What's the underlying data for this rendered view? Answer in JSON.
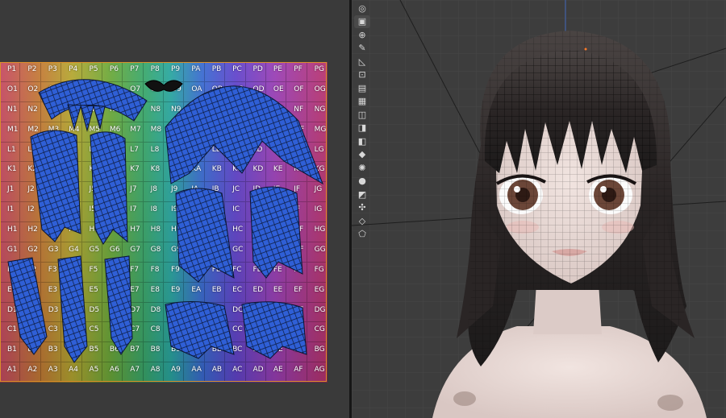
{
  "uv_editor": {
    "grid_rows": [
      [
        "P1",
        "P2",
        "P3",
        "P4",
        "P5",
        "P6",
        "P7",
        "P8",
        "P9",
        "PA",
        "PB",
        "PC",
        "PD",
        "PE",
        "PF",
        "PG"
      ],
      [
        "O1",
        "O2",
        "O3",
        "O4",
        "O5",
        "O6",
        "O7",
        "O8",
        "O9",
        "OA",
        "OB",
        "OC",
        "OD",
        "OE",
        "OF",
        "OG"
      ],
      [
        "N1",
        "N2",
        "N3",
        "N4",
        "N5",
        "N6",
        "N7",
        "N8",
        "N9",
        "NA",
        "NB",
        "NC",
        "ND",
        "NE",
        "NF",
        "NG"
      ],
      [
        "M1",
        "M2",
        "M3",
        "M4",
        "M5",
        "M6",
        "M7",
        "M8",
        "M9",
        "MA",
        "MB",
        "MC",
        "MD",
        "ME",
        "MF",
        "MG"
      ],
      [
        "L1",
        "L2",
        "L3",
        "L4",
        "L5",
        "L6",
        "L7",
        "L8",
        "L9",
        "LA",
        "LB",
        "LC",
        "LD",
        "LE",
        "LF",
        "LG"
      ],
      [
        "K1",
        "K2",
        "K3",
        "K4",
        "K5",
        "K6",
        "K7",
        "K8",
        "K9",
        "KA",
        "KB",
        "KC",
        "KD",
        "KE",
        "KF",
        "KG"
      ],
      [
        "J1",
        "J2",
        "J3",
        "J4",
        "J5",
        "J6",
        "J7",
        "J8",
        "J9",
        "JA",
        "JB",
        "JC",
        "JD",
        "JE",
        "JF",
        "JG"
      ],
      [
        "I1",
        "I2",
        "I3",
        "I4",
        "I5",
        "I6",
        "I7",
        "I8",
        "I9",
        "IA",
        "IB",
        "IC",
        "ID",
        "IE",
        "IF",
        "IG"
      ],
      [
        "H1",
        "H2",
        "H3",
        "H4",
        "H5",
        "H6",
        "H7",
        "H8",
        "H9",
        "HA",
        "HB",
        "HC",
        "HD",
        "HE",
        "HF",
        "HG"
      ],
      [
        "G1",
        "G2",
        "G3",
        "G4",
        "G5",
        "G6",
        "G7",
        "G8",
        "G9",
        "GA",
        "GB",
        "GC",
        "GD",
        "GE",
        "GF",
        "GG"
      ],
      [
        "F1",
        "F2",
        "F3",
        "F4",
        "F5",
        "F6",
        "F7",
        "F8",
        "F9",
        "FA",
        "FB",
        "FC",
        "FD",
        "FE",
        "FF",
        "FG"
      ],
      [
        "E1",
        "E2",
        "E3",
        "E4",
        "E5",
        "E6",
        "E7",
        "E8",
        "E9",
        "EA",
        "EB",
        "EC",
        "ED",
        "EE",
        "EF",
        "EG"
      ],
      [
        "D1",
        "D2",
        "D3",
        "D4",
        "D5",
        "D6",
        "D7",
        "D8",
        "D9",
        "DA",
        "DB",
        "DC",
        "DD",
        "DE",
        "DF",
        "DG"
      ],
      [
        "C1",
        "C2",
        "C3",
        "C4",
        "C5",
        "C6",
        "C7",
        "C8",
        "C9",
        "CA",
        "CB",
        "CC",
        "CD",
        "CE",
        "CF",
        "CG"
      ],
      [
        "B1",
        "B2",
        "B3",
        "B4",
        "B5",
        "B6",
        "B7",
        "B8",
        "B9",
        "BA",
        "BB",
        "BC",
        "BD",
        "BE",
        "BF",
        "BG"
      ],
      [
        "A1",
        "A2",
        "A3",
        "A4",
        "A5",
        "A6",
        "A7",
        "A8",
        "A9",
        "AA",
        "AB",
        "AC",
        "AD",
        "AE",
        "AF",
        "AG"
      ]
    ],
    "border_color": "#d98f2a",
    "island_color": "#2f5fd6"
  },
  "toolbar": {
    "tools": [
      {
        "name": "cursor-icon",
        "glyph": "◎"
      },
      {
        "name": "box-select-icon",
        "glyph": "▣"
      },
      {
        "name": "transform-icon",
        "glyph": "⊕"
      },
      {
        "name": "annotate-icon",
        "glyph": "✎"
      },
      {
        "name": "measure-icon",
        "glyph": "◺"
      },
      {
        "name": "add-cube-icon",
        "glyph": "⊡"
      },
      {
        "name": "extrude-icon",
        "glyph": "▤"
      },
      {
        "name": "inset-icon",
        "glyph": "▦"
      },
      {
        "name": "bevel-icon",
        "glyph": "◫"
      },
      {
        "name": "loop-cut-icon",
        "glyph": "◨"
      },
      {
        "name": "knife-icon",
        "glyph": "◧"
      },
      {
        "name": "poly-build-icon",
        "glyph": "◆"
      },
      {
        "name": "spin-icon",
        "glyph": "✺"
      },
      {
        "name": "smooth-icon",
        "glyph": "●"
      },
      {
        "name": "edge-slide-icon",
        "glyph": "◩"
      },
      {
        "name": "shrink-fatten-icon",
        "glyph": "✣"
      },
      {
        "name": "shear-icon",
        "glyph": "◇"
      },
      {
        "name": "rip-region-icon",
        "glyph": "⬠"
      }
    ]
  }
}
